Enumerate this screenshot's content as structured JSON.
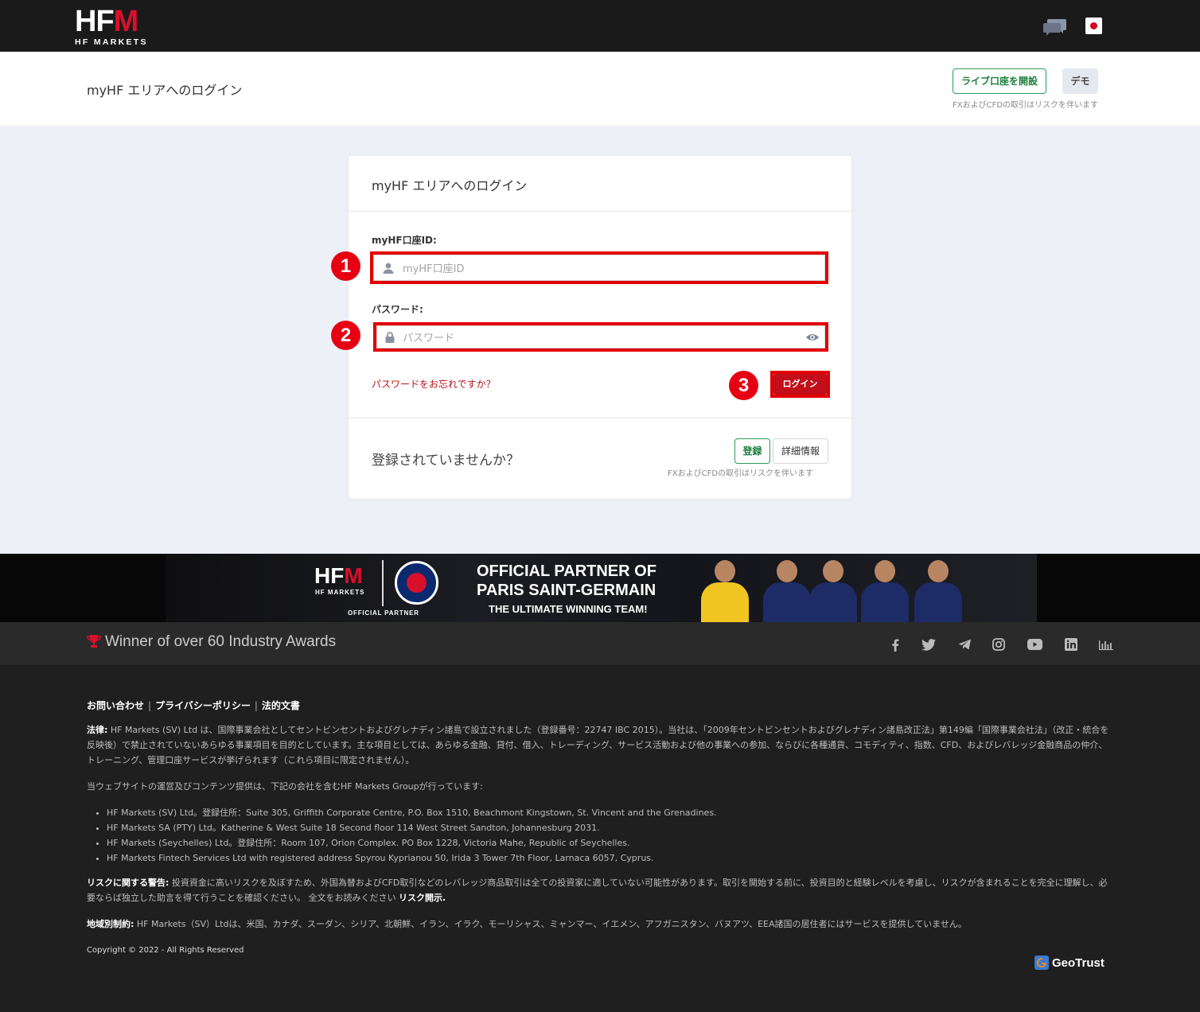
{
  "topbar": {
    "logo_main": "HFM",
    "logo_sub": "HF MARKETS"
  },
  "header": {
    "title": "myHF エリアへのログイン",
    "open_live_label": "ライブ口座を開設",
    "demo_label": "デモ",
    "risk_note": "FXおよびCFDの取引はリスクを伴います"
  },
  "login_card": {
    "title": "myHF エリアへのログイン",
    "id_label": "myHF口座ID:",
    "id_placeholder": "myHF口座ID",
    "password_label": "パスワード:",
    "password_placeholder": "パスワード",
    "forgot_label": "パスワードをお忘れですか？",
    "login_label": "ログイン",
    "not_registered": "登録されていませんか？",
    "register_label": "登録",
    "more_info_label": "詳細情報",
    "risk_note": "FXおよびCFDの取引はリスクを伴います",
    "step_numbers": [
      "1",
      "2",
      "3"
    ],
    "highlight_color": "#e30000"
  },
  "banner": {
    "logo_main": "HFM",
    "logo_sub": "HF MARKETS",
    "official_partner": "OFFICIAL PARTNER",
    "headline_1": "OFFICIAL PARTNER OF",
    "headline_2": "PARIS SAINT-GERMAIN",
    "tagline": "THE ULTIMATE WINNING TEAM!"
  },
  "awards": {
    "text": "Winner of over 60 Industry Awards",
    "social_icons": [
      "facebook-icon",
      "twitter-icon",
      "telegram-icon",
      "instagram-icon",
      "youtube-icon",
      "linkedin-icon",
      "chart-icon"
    ]
  },
  "footer": {
    "links": [
      "お問い合わせ",
      "プライバシーポリシー",
      "法的文書"
    ],
    "legal_label": "法律:",
    "legal_text": " HF Markets (SV) Ltd は、国際事業会社としてセントビンセントおよびグレナディン諸島で設立されました（登録番号：22747 IBC 2015）。当社は、「2009年セントビンセントおよびグレナディン諸島改正法」第149編「国際事業会社法」（改正・統合を反映後）で禁止されていないあらゆる事業項目を目的としています。主な項目としては、あらゆる金融、貸付、借入、トレーディング、サービス活動および他の事業への参加、ならびに各種通貨、コモディティ、指数、CFD、およびレバレッジ金融商品の仲介、トレーニング、管理口座サービスが挙げられます（これら項目に限定されません）。",
    "group_text": "当ウェブサイトの運営及びコンテンツ提供は、下記の会社を含むHF Markets Groupが行っています:",
    "companies": [
      "HF Markets (SV) Ltd。登録住所：Suite 305, Griffith Corporate Centre, P.O. Box 1510, Beachmont Kingstown, St. Vincent and the Grenadines.",
      "HF Markets SA (PTY) Ltd。Katherine & West Suite 18 Second floor 114 West Street Sandton, Johannesburg 2031.",
      "HF Markets (Seychelles) Ltd。登録住所：Room 107, Orion Complex. PO Box 1228, Victoria Mahe, Republic of Seychelles.",
      "HF Markets Fintech Services Ltd with registered address Spyrou Kyprianou 50, Irida 3 Tower 7th Floor, Larnaca 6057, Cyprus."
    ],
    "risk_label": "リスクに関する警告:",
    "risk_text": " 投資資金に高いリスクを及ぼすため、外国為替およびCFD取引などのレバレッジ商品取引は全ての投資家に適していない可能性があります。取引を開始する前に、投資目的と経験レベルを考慮し、リスクが含まれることを完全に理解し、必要ならば独立した助言を得て行うことを確認ください。 全文をお読みください ",
    "risk_link": "リスク開示.",
    "region_label": "地域別制約:",
    "region_text": " HF Markets（SV）Ltdは、米国、カナダ、スーダン、シリア、北朝鮮、イラン、イラク、モーリシャス、ミャンマー、イエメン、アフガニスタン、バヌアツ、EEA諸国の居住者にはサービスを提供していません。",
    "copyright": "Copyright © 2022 - All Rights Reserved",
    "geotrust": "GeoTrust"
  }
}
